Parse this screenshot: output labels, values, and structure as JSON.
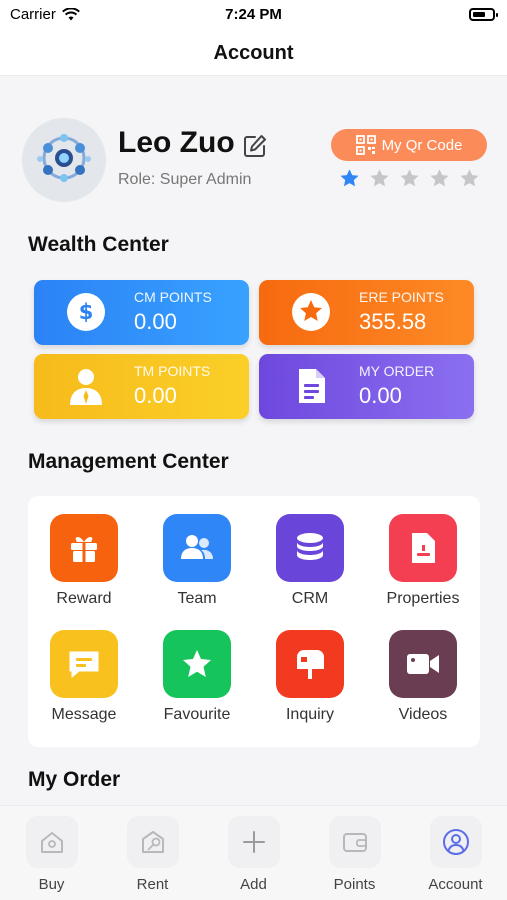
{
  "status_bar": {
    "carrier": "Carrier",
    "time": "7:24 PM"
  },
  "header": {
    "title": "Account"
  },
  "profile": {
    "name": "Leo Zuo",
    "role": "Role: Super Admin",
    "qr_label": "My Qr Code",
    "rating": 1,
    "rating_max": 5
  },
  "wealth": {
    "title": "Wealth Center",
    "cards": [
      {
        "label": "CM POINTS",
        "value": "0.00",
        "icon": "dollar-icon"
      },
      {
        "label": "ERE POINTS",
        "value": "355.58",
        "icon": "star-badge-icon"
      },
      {
        "label": "TM POINTS",
        "value": "0.00",
        "icon": "person-icon"
      },
      {
        "label": "MY ORDER",
        "value": "0.00",
        "icon": "document-icon"
      }
    ]
  },
  "management": {
    "title": "Management Center",
    "items": [
      {
        "label": "Reward",
        "icon": "gift-icon",
        "color": "#f7620f"
      },
      {
        "label": "Team",
        "icon": "team-icon",
        "color": "#2f86f6"
      },
      {
        "label": "CRM",
        "icon": "database-icon",
        "color": "#6a45d9"
      },
      {
        "label": "Properties",
        "icon": "file-icon",
        "color": "#f43e52"
      },
      {
        "label": "Message",
        "icon": "message-icon",
        "color": "#f8c11d"
      },
      {
        "label": "Favourite",
        "icon": "star-icon",
        "color": "#16c45c"
      },
      {
        "label": "Inquiry",
        "icon": "mailbox-icon",
        "color": "#f23a21"
      },
      {
        "label": "Videos",
        "icon": "video-icon",
        "color": "#6b3d52"
      }
    ]
  },
  "my_order": {
    "title": "My Order"
  },
  "tab_bar": {
    "tabs": [
      {
        "label": "Buy",
        "icon": "house-icon",
        "active": false
      },
      {
        "label": "Rent",
        "icon": "rent-icon",
        "active": false
      },
      {
        "label": "Add",
        "icon": "plus-icon",
        "active": false
      },
      {
        "label": "Points",
        "icon": "wallet-icon",
        "active": false
      },
      {
        "label": "Account",
        "icon": "account-icon",
        "active": true
      }
    ]
  },
  "colors": {
    "accent": "#2f86f6",
    "qr_button": "#fb8c5a",
    "star_active": "#2f86f6",
    "star_inactive": "#c6c6c8"
  }
}
